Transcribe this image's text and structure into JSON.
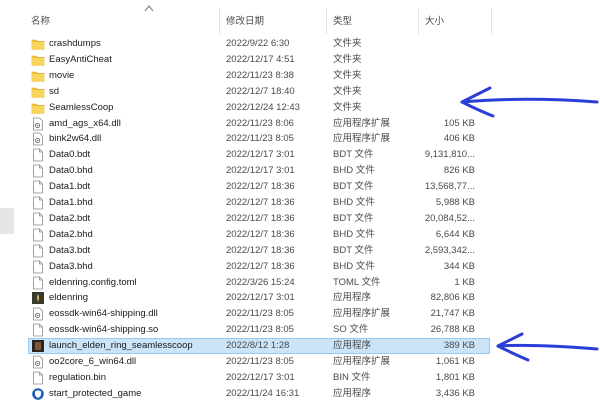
{
  "columns": {
    "name": "名称",
    "date": "修改日期",
    "type": "类型",
    "size": "大小"
  },
  "files": [
    {
      "name": "crashdumps",
      "date": "2022/9/22 6:30",
      "type": "文件夹",
      "size": "",
      "icon": "folder-icon"
    },
    {
      "name": "EasyAntiCheat",
      "date": "2022/12/17 4:51",
      "type": "文件夹",
      "size": "",
      "icon": "folder-icon"
    },
    {
      "name": "movie",
      "date": "2022/11/23 8:38",
      "type": "文件夹",
      "size": "",
      "icon": "folder-icon"
    },
    {
      "name": "sd",
      "date": "2022/12/7 18:40",
      "type": "文件夹",
      "size": "",
      "icon": "folder-icon"
    },
    {
      "name": "SeamlessCoop",
      "date": "2022/12/24 12:43",
      "type": "文件夹",
      "size": "",
      "icon": "folder-icon"
    },
    {
      "name": "amd_ags_x64.dll",
      "date": "2022/11/23 8:06",
      "type": "应用程序扩展",
      "size": "105 KB",
      "icon": "dll-icon"
    },
    {
      "name": "bink2w64.dll",
      "date": "2022/11/23 8:05",
      "type": "应用程序扩展",
      "size": "406 KB",
      "icon": "dll-icon"
    },
    {
      "name": "Data0.bdt",
      "date": "2022/12/17 3:01",
      "type": "BDT 文件",
      "size": "9,131,810...",
      "icon": "file-icon"
    },
    {
      "name": "Data0.bhd",
      "date": "2022/12/17 3:01",
      "type": "BHD 文件",
      "size": "826 KB",
      "icon": "file-icon"
    },
    {
      "name": "Data1.bdt",
      "date": "2022/12/7 18:36",
      "type": "BDT 文件",
      "size": "13,568,77...",
      "icon": "file-icon"
    },
    {
      "name": "Data1.bhd",
      "date": "2022/12/7 18:36",
      "type": "BHD 文件",
      "size": "5,988 KB",
      "icon": "file-icon"
    },
    {
      "name": "Data2.bdt",
      "date": "2022/12/7 18:36",
      "type": "BDT 文件",
      "size": "20,084,52...",
      "icon": "file-icon"
    },
    {
      "name": "Data2.bhd",
      "date": "2022/12/7 18:36",
      "type": "BHD 文件",
      "size": "6,644 KB",
      "icon": "file-icon"
    },
    {
      "name": "Data3.bdt",
      "date": "2022/12/7 18:36",
      "type": "BDT 文件",
      "size": "2,593,342...",
      "icon": "file-icon"
    },
    {
      "name": "Data3.bhd",
      "date": "2022/12/7 18:36",
      "type": "BHD 文件",
      "size": "344 KB",
      "icon": "file-icon"
    },
    {
      "name": "eldenring.config.toml",
      "date": "2022/3/26 15:24",
      "type": "TOML 文件",
      "size": "1 KB",
      "icon": "file-icon"
    },
    {
      "name": "eldenring",
      "date": "2022/12/17 3:01",
      "type": "应用程序",
      "size": "82,806 KB",
      "icon": "eldenring-app-icon"
    },
    {
      "name": "eossdk-win64-shipping.dll",
      "date": "2022/11/23 8:05",
      "type": "应用程序扩展",
      "size": "21,747 KB",
      "icon": "dll-icon"
    },
    {
      "name": "eossdk-win64-shipping.so",
      "date": "2022/11/23 8:05",
      "type": "SO 文件",
      "size": "26,788 KB",
      "icon": "file-icon"
    },
    {
      "name": "launch_elden_ring_seamlesscoop",
      "date": "2022/8/12 1:28",
      "type": "应用程序",
      "size": "389 KB",
      "icon": "launcher-app-icon",
      "selected": true
    },
    {
      "name": "oo2core_6_win64.dll",
      "date": "2022/11/23 8:05",
      "type": "应用程序扩展",
      "size": "1,061 KB",
      "icon": "dll-icon"
    },
    {
      "name": "regulation.bin",
      "date": "2022/12/17 3:01",
      "type": "BIN 文件",
      "size": "1,801 KB",
      "icon": "file-icon"
    },
    {
      "name": "start_protected_game",
      "date": "2022/11/24 16:31",
      "type": "应用程序",
      "size": "3,436 KB",
      "icon": "shield-app-icon"
    }
  ],
  "annotation_color": "#2b3fd6",
  "selection_color": "#cce4f7"
}
